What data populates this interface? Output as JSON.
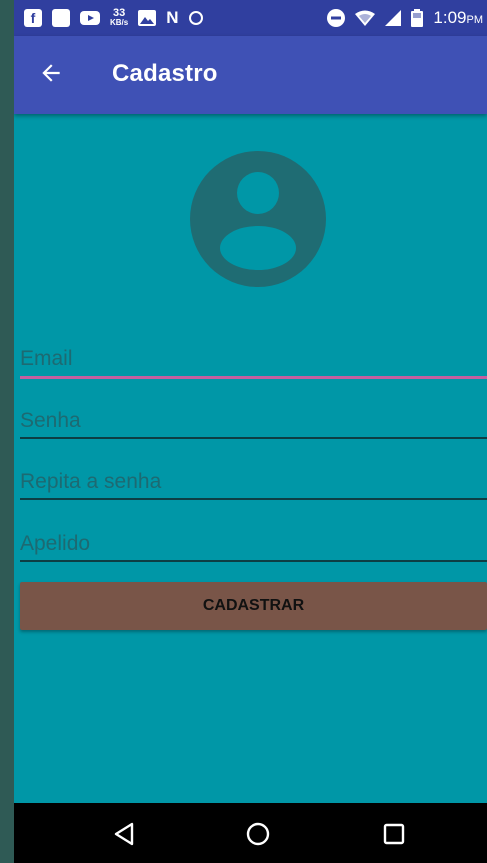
{
  "status_bar": {
    "net_speed_value": "33",
    "net_speed_unit": "KB/s",
    "time": "1:09",
    "ampm": "PM"
  },
  "app_bar": {
    "title": "Cadastro"
  },
  "form": {
    "email_placeholder": "Email",
    "password_placeholder": "Senha",
    "repeat_password_placeholder": "Repita a senha",
    "nickname_placeholder": "Apelido",
    "submit_label": "CADASTRAR"
  },
  "colors": {
    "status_bar": "#303f9f",
    "app_bar": "#3f51b5",
    "background": "#0097a7",
    "button": "#795548",
    "focus_underline": "#c45fa0"
  },
  "icons": [
    "facebook-icon",
    "app-icon",
    "youtube-icon",
    "image-icon",
    "n-icon",
    "vpn-icon",
    "dnd-icon",
    "wifi-icon",
    "signal-icon",
    "battery-icon",
    "back-arrow-icon",
    "avatar-icon",
    "nav-back-icon",
    "nav-home-icon",
    "nav-recents-icon"
  ]
}
